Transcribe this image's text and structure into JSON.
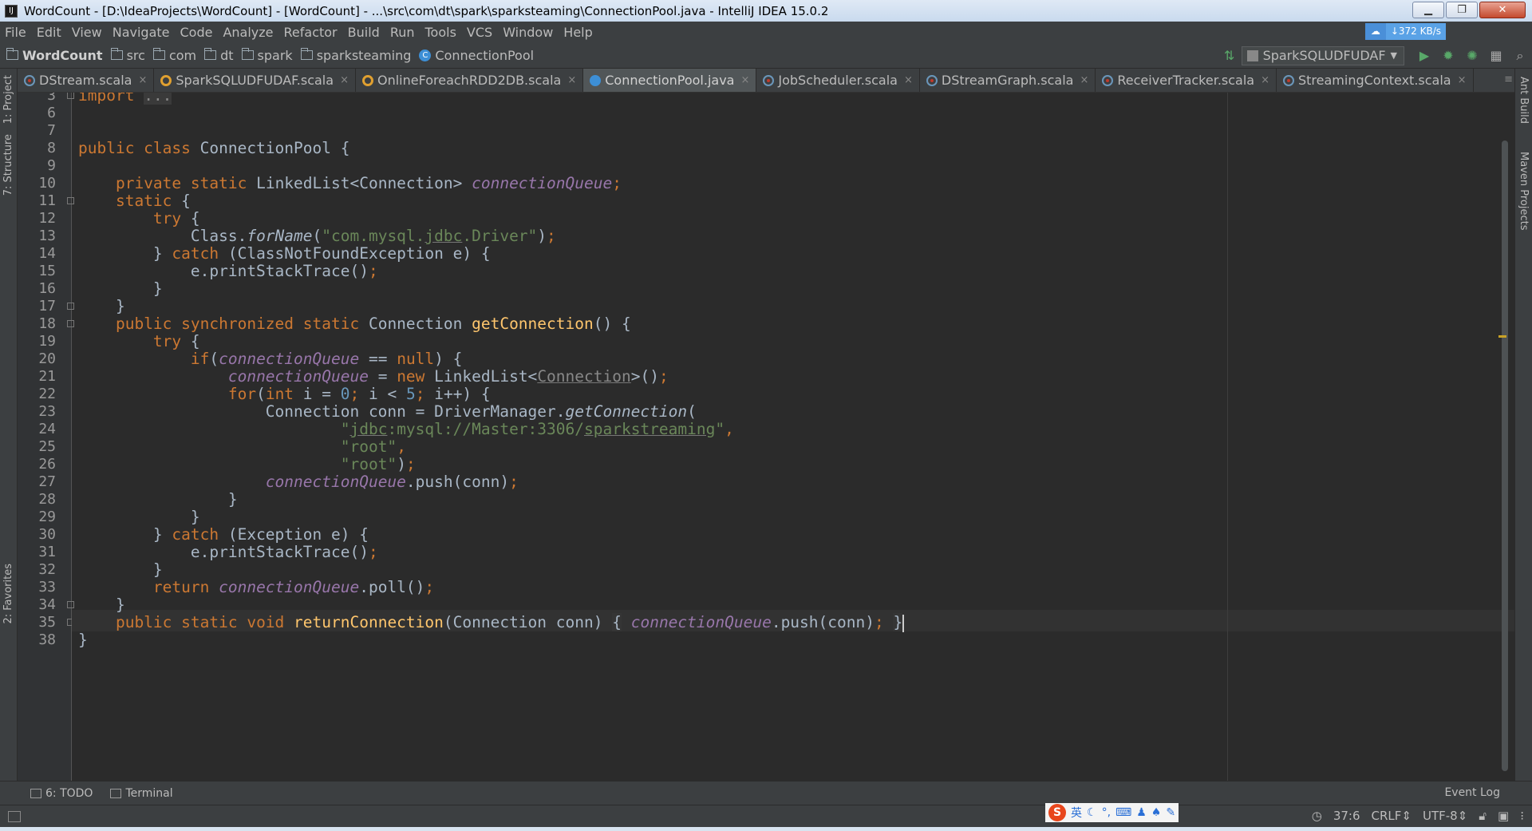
{
  "window": {
    "title": "WordCount - [D:\\IdeaProjects\\WordCount] - [WordCount] - ...\\src\\com\\dt\\spark\\sparksteaming\\ConnectionPool.java - IntelliJ IDEA 15.0.2",
    "app_icon_glyph": "IJ"
  },
  "menu": [
    "File",
    "Edit",
    "View",
    "Navigate",
    "Code",
    "Analyze",
    "Refactor",
    "Build",
    "Run",
    "Tools",
    "VCS",
    "Window",
    "Help"
  ],
  "network": {
    "speed": "↓372 KB/s"
  },
  "breadcrumb": [
    "WordCount",
    "src",
    "com",
    "dt",
    "spark",
    "sparksteaming",
    "ConnectionPool"
  ],
  "run_config": "SparkSQLUDFUDAF",
  "tabs": [
    {
      "label": "DStream.scala",
      "icon": "scala"
    },
    {
      "label": "SparkSQLUDFUDAF.scala",
      "icon": "orange"
    },
    {
      "label": "OnlineForeachRDD2DB.scala",
      "icon": "orange"
    },
    {
      "label": "ConnectionPool.java",
      "icon": "blue",
      "active": true
    },
    {
      "label": "JobScheduler.scala",
      "icon": "scala"
    },
    {
      "label": "DStreamGraph.scala",
      "icon": "scala"
    },
    {
      "label": "ReceiverTracker.scala",
      "icon": "scala"
    },
    {
      "label": "StreamingContext.scala",
      "icon": "scala"
    }
  ],
  "left_tools": [
    "1: Project",
    "7: Structure",
    "2: Favorites"
  ],
  "right_tools": [
    "Ant Build",
    "Maven Projects"
  ],
  "bottom_tools": {
    "todo": "6: TODO",
    "terminal": "Terminal",
    "event_log": "Event Log"
  },
  "status": {
    "position": "37:6",
    "line_sep": "CRLF",
    "encoding": "UTF-8"
  },
  "ime": {
    "lang": "英"
  },
  "code_lines": [
    {
      "n": "3",
      "html": "<span class='kw'>import</span> <span class='fold-text'>...</span>"
    },
    {
      "n": "6",
      "html": ""
    },
    {
      "n": "7",
      "html": ""
    },
    {
      "n": "8",
      "html": "<span class='kw'>public class</span> ConnectionPool {"
    },
    {
      "n": "9",
      "html": ""
    },
    {
      "n": "10",
      "html": "    <span class='kw'>private static</span> LinkedList&lt;Connection&gt; <span class='fld'>connectionQueue</span><span class='kw'>;</span>"
    },
    {
      "n": "11",
      "html": "    <span class='kw'>static</span> {"
    },
    {
      "n": "12",
      "html": "        <span class='kw'>try</span> {"
    },
    {
      "n": "13",
      "html": "            Class.<span class='itl'>forName</span>(<span class='str'>\"com.mysql.<span class='ul'>jdbc</span>.Driver\"</span>)<span class='kw'>;</span>"
    },
    {
      "n": "14",
      "html": "        } <span class='kw'>catch</span> (ClassNotFoundException e) {"
    },
    {
      "n": "15",
      "html": "            e.printStackTrace()<span class='kw'>;</span>"
    },
    {
      "n": "16",
      "html": "        }"
    },
    {
      "n": "17",
      "html": "    }"
    },
    {
      "n": "18",
      "html": "    <span class='kw'>public synchronized static</span> Connection <span class='fn'>getConnection</span>() {"
    },
    {
      "n": "19",
      "html": "        <span class='kw'>try</span> {"
    },
    {
      "n": "20",
      "html": "            <span class='kw'>if</span>(<span class='fld'>connectionQueue</span> == <span class='kw'>null</span>) {"
    },
    {
      "n": "21",
      "html": "                <span class='fld'>connectionQueue</span> = <span class='kw'>new</span> LinkedList&lt;<span class='ul' style='color:#888'>Connection</span>&gt;()<span class='kw'>;</span>"
    },
    {
      "n": "22",
      "html": "                <span class='kw'>for</span>(<span class='kw'>int</span> i = <span class='num'>0</span><span class='kw'>;</span> i &lt; <span class='num'>5</span><span class='kw'>;</span> i++) {"
    },
    {
      "n": "23",
      "html": "                    Connection conn = DriverManager.<span class='itl'>getConnection</span>("
    },
    {
      "n": "24",
      "html": "                            <span class='str'>\"<span class='ul'>jdbc</span>:mysql://Master:3306/<span class='ul'>sparkstreaming</span>\"</span><span class='kw'>,</span>"
    },
    {
      "n": "25",
      "html": "                            <span class='str'>\"root\"</span><span class='kw'>,</span>"
    },
    {
      "n": "26",
      "html": "                            <span class='str'>\"root\"</span>)<span class='kw'>;</span>"
    },
    {
      "n": "27",
      "html": "                    <span class='fld'>connectionQueue</span>.push(conn)<span class='kw'>;</span>"
    },
    {
      "n": "28",
      "html": "                }"
    },
    {
      "n": "29",
      "html": "            }"
    },
    {
      "n": "30",
      "html": "        } <span class='kw'>catch</span> (Exception e) {"
    },
    {
      "n": "31",
      "html": "            e.printStackTrace()<span class='kw'>;</span>"
    },
    {
      "n": "32",
      "html": "        }"
    },
    {
      "n": "33",
      "html": "        <span class='kw'>return</span> <span class='fld'>connectionQueue</span>.poll()<span class='kw'>;</span>"
    },
    {
      "n": "34",
      "html": "    }"
    },
    {
      "n": "35",
      "html": "    <span class='kw'>public static void</span> <span class='fn'>returnConnection</span>(Connection conn) <span class='fold-text' style='background:#353535;color:#a9b7c6'>{</span> <span class='fld'>connectionQueue</span>.push(conn)<span class='kw'>;</span> <span class='fold-text' style='background:#353535;color:#a9b7c6'>}</span><span class='caret'></span>"
    },
    {
      "n": "38",
      "html": "}"
    }
  ]
}
